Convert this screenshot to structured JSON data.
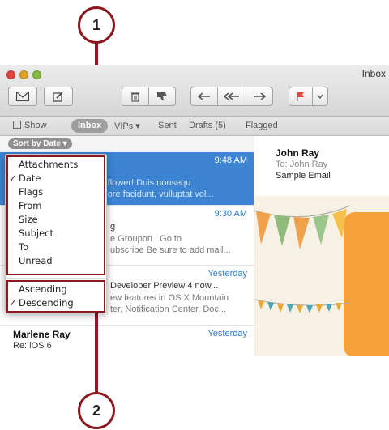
{
  "callouts": {
    "one": "1",
    "two": "2"
  },
  "window": {
    "title": "Inbox"
  },
  "toolbar": {
    "buttons": [
      "get-mail",
      "compose",
      "delete",
      "junk",
      "reply",
      "reply-all",
      "forward",
      "flag",
      "flag-menu"
    ]
  },
  "favorites": {
    "show": "Show",
    "inbox": "Inbox",
    "vips": "VIPs ▾",
    "sent": "Sent",
    "drafts": "Drafts (5)",
    "flagged": "Flagged"
  },
  "sort_button": "Sort by Date ▾",
  "sort_menu": {
    "items": [
      {
        "label": "Attachments",
        "checked": false
      },
      {
        "label": "Date",
        "checked": true
      },
      {
        "label": "Flags",
        "checked": false
      },
      {
        "label": "From",
        "checked": false
      },
      {
        "label": "Size",
        "checked": false
      },
      {
        "label": "Subject",
        "checked": false
      },
      {
        "label": "To",
        "checked": false
      },
      {
        "label": "Unread",
        "checked": false
      }
    ],
    "order": [
      {
        "label": "Ascending",
        "checked": false
      },
      {
        "label": "Descending",
        "checked": true
      }
    ],
    "check_glyph": "✓"
  },
  "messages": [
    {
      "time": "9:48 AM",
      "line1": "tty flower! Duis nonsequ",
      "line2": "dolore facidunt, vulluptat vol..."
    },
    {
      "time": "9:30 AM",
      "line1": "g",
      "line2": "e Groupon I Go to",
      "line3": "ubscribe Be sure to add mail..."
    },
    {
      "time": "Yesterday",
      "line1": "Developer Preview 4 now...",
      "line2": "ew features in OS X Mountain",
      "line3": "ter, Notification Center, Doc..."
    },
    {
      "time": "Yesterday",
      "sender": "Marlene Ray",
      "subject": "Re: iOS 6"
    }
  ],
  "preview": {
    "from": "John Ray",
    "to": "To:  John Ray",
    "subject": "Sample Email"
  },
  "colors": {
    "callout": "#8b1a20",
    "selection": "#3d84d2",
    "time_link": "#2a7bd5"
  }
}
